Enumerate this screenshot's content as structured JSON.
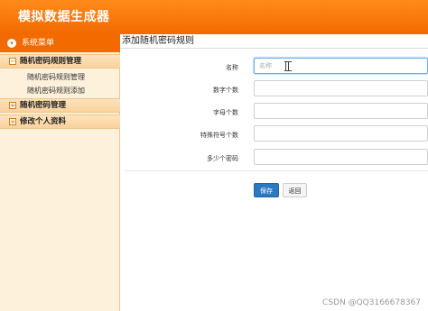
{
  "app": {
    "title": "模拟数据生成器"
  },
  "sidebar": {
    "header": "系统菜单",
    "groups": [
      {
        "label": "随机密码规则管理",
        "items": [
          "随机密码规则管理",
          "随机密码规则添加"
        ]
      },
      {
        "label": "随机密码管理",
        "items": []
      },
      {
        "label": "修改个人资料",
        "items": []
      }
    ]
  },
  "panel": {
    "title": "添加随机密码规则"
  },
  "form": {
    "fields": [
      {
        "label": "名称",
        "value": "",
        "placeholder": "名称"
      },
      {
        "label": "数字个数",
        "value": "",
        "placeholder": ""
      },
      {
        "label": "字母个数",
        "value": "",
        "placeholder": ""
      },
      {
        "label": "特殊符号个数",
        "value": "",
        "placeholder": ""
      },
      {
        "label": "多少个密码",
        "value": "",
        "placeholder": ""
      }
    ],
    "save_label": "保存",
    "back_label": "返回"
  },
  "watermark": "CSDN @QQ3166678367",
  "colors": {
    "accent": "#f26a00",
    "sidebar_bg": "#fdf1dc",
    "primary_button": "#2b79c2"
  }
}
